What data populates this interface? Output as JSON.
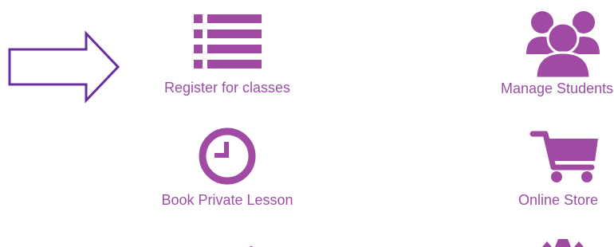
{
  "tiles": [
    {
      "label": "Register for classes",
      "icon": "list-icon"
    },
    {
      "label": "Manage Students",
      "icon": "users-icon"
    },
    {
      "label": "Book Private Lesson",
      "icon": "clock-icon"
    },
    {
      "label": "Online Store",
      "icon": "cart-icon"
    }
  ],
  "colors": {
    "accent": "#a04aa4",
    "label": "#9b4ea6",
    "arrow": "#6a2c9e"
  }
}
